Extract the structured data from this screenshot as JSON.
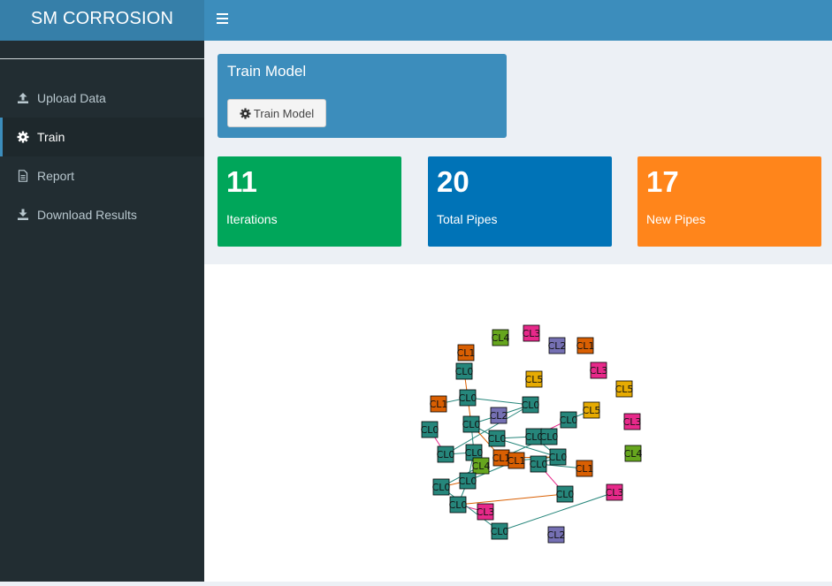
{
  "app": {
    "title": "SM CORROSION"
  },
  "header": {
    "toggle_icon": "hamburger-icon"
  },
  "sidebar": {
    "items": [
      {
        "label": "Upload Data",
        "icon": "upload-icon",
        "active": false
      },
      {
        "label": "Train",
        "icon": "gear-icon",
        "active": true
      },
      {
        "label": "Report",
        "icon": "file-icon",
        "active": false
      },
      {
        "label": "Download Results",
        "icon": "download-icon",
        "active": false
      }
    ]
  },
  "train": {
    "title": "Train Model",
    "button_label": "Train Model",
    "button_icon": "gear-icon"
  },
  "value_boxes": [
    {
      "value": "11",
      "label": "Iterations",
      "color": "#00a65a"
    },
    {
      "value": "20",
      "label": "Total Pipes",
      "color": "#0073b7"
    },
    {
      "value": "17",
      "label": "New Pipes",
      "color": "#ff851b"
    }
  ],
  "colors": {
    "brand": "#3c8dbc",
    "sidebar": "#222d32"
  },
  "graph": {
    "cluster_colors": {
      "CL0": "#26867b",
      "CL1": "#d95f02",
      "CL2": "#7570b3",
      "CL3": "#e7298a",
      "CL4": "#66a61e",
      "CL5": "#e6ab02"
    },
    "nodes": [
      {
        "id": "n1",
        "label": "CL4"
      },
      {
        "id": "n2",
        "label": "CL3"
      },
      {
        "id": "n3",
        "label": "CL2"
      },
      {
        "id": "n4",
        "label": "CL1"
      },
      {
        "id": "n5",
        "label": "CL1"
      },
      {
        "id": "n6",
        "label": "CL3"
      },
      {
        "id": "n7",
        "label": "CL0"
      },
      {
        "id": "n8",
        "label": "CL5"
      },
      {
        "id": "n9",
        "label": "CL5"
      },
      {
        "id": "n10",
        "label": "CL0"
      },
      {
        "id": "n11",
        "label": "CL1"
      },
      {
        "id": "n12",
        "label": "CL0"
      },
      {
        "id": "n13",
        "label": "CL2"
      },
      {
        "id": "n14",
        "label": "CL5"
      },
      {
        "id": "n15",
        "label": "CL0"
      },
      {
        "id": "n16",
        "label": "CL3"
      },
      {
        "id": "n17",
        "label": "CL0"
      },
      {
        "id": "n18",
        "label": "CL0"
      },
      {
        "id": "n19",
        "label": "CL0"
      },
      {
        "id": "n20",
        "label": "CL0"
      },
      {
        "id": "n21",
        "label": "CL0"
      },
      {
        "id": "n22",
        "label": "CL0"
      },
      {
        "id": "n23",
        "label": "CL4"
      },
      {
        "id": "n24",
        "label": "CL0"
      },
      {
        "id": "n25",
        "label": "CL4"
      },
      {
        "id": "n26",
        "label": "CL1"
      },
      {
        "id": "n27",
        "label": "CL0"
      },
      {
        "id": "n28",
        "label": "CL0"
      },
      {
        "id": "n29",
        "label": "CL1"
      },
      {
        "id": "n30",
        "label": "CL0"
      },
      {
        "id": "n31",
        "label": "CL0"
      },
      {
        "id": "n32",
        "label": "CL0"
      },
      {
        "id": "n33",
        "label": "CL3"
      },
      {
        "id": "n34",
        "label": "CL1"
      },
      {
        "id": "n35",
        "label": "CL0"
      },
      {
        "id": "n36",
        "label": "CL0"
      },
      {
        "id": "n37",
        "label": "CL3"
      },
      {
        "id": "n38",
        "label": "CL2"
      }
    ],
    "edges": [
      [
        "n7",
        "n10"
      ],
      [
        "n10",
        "n12"
      ],
      [
        "n11",
        "n10"
      ],
      [
        "n12",
        "n13"
      ],
      [
        "n13",
        "n17"
      ],
      [
        "n10",
        "n17"
      ],
      [
        "n12",
        "n19"
      ],
      [
        "n15",
        "n19"
      ],
      [
        "n19",
        "n24"
      ],
      [
        "n24",
        "n27"
      ],
      [
        "n27",
        "n28"
      ],
      [
        "n24",
        "n25"
      ],
      [
        "n25",
        "n28"
      ],
      [
        "n27",
        "n32"
      ],
      [
        "n32",
        "n33"
      ],
      [
        "n32",
        "n36"
      ],
      [
        "n28",
        "n35"
      ],
      [
        "n35",
        "n37"
      ],
      [
        "n17",
        "n20"
      ],
      [
        "n20",
        "n21"
      ],
      [
        "n21",
        "n22"
      ],
      [
        "n18",
        "n21"
      ],
      [
        "n14",
        "n18"
      ],
      [
        "n20",
        "n30"
      ],
      [
        "n30",
        "n29"
      ],
      [
        "n30",
        "n26"
      ],
      [
        "n30",
        "n31"
      ],
      [
        "n31",
        "n34"
      ],
      [
        "n31",
        "n36"
      ],
      [
        "n26",
        "n22"
      ],
      [
        "n17",
        "n26"
      ],
      [
        "n24",
        "n17"
      ],
      [
        "n27",
        "n29"
      ],
      [
        "n21",
        "n30"
      ]
    ]
  }
}
